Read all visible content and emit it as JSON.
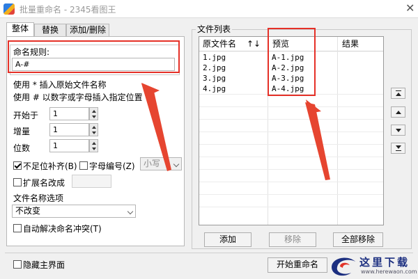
{
  "window": {
    "title": "批量重命名 - 2345看图王",
    "close_glyph": "✕"
  },
  "tabs": [
    "整体",
    "替换",
    "添加/删除"
  ],
  "naming_rule": {
    "label": "命名规则:",
    "value": "A-#"
  },
  "usage": [
    "使用 * 插入原始文件名称",
    "使用 # 以数字或字母插入指定位置"
  ],
  "start_at": {
    "label": "开始于",
    "value": "1"
  },
  "increment": {
    "label": "增量",
    "value": "1"
  },
  "digits": {
    "label": "位数",
    "value": "1"
  },
  "zero_pad": {
    "label": "不足位补齐(B)",
    "checked": true
  },
  "letter_numbering": {
    "label": "字母编号(Z)",
    "checked": false
  },
  "letter_case": {
    "value": "小写"
  },
  "change_extension": {
    "label": "扩展名改成",
    "checked": false,
    "value": ""
  },
  "filename_options": {
    "label": "文件名称选项",
    "value": "不改变"
  },
  "auto_resolve": {
    "label": "自动解决命名冲突(T)",
    "checked": false
  },
  "file_list": {
    "legend": "文件列表",
    "columns": {
      "original": "原文件名",
      "sort": "↑↓",
      "preview": "预览",
      "result": "结果"
    },
    "rows": [
      {
        "original": "1.jpg",
        "preview": "A-1.jpg",
        "result": ""
      },
      {
        "original": "2.jpg",
        "preview": "A-2.jpg",
        "result": ""
      },
      {
        "original": "3.jpg",
        "preview": "A-3.jpg",
        "result": ""
      },
      {
        "original": "4.jpg",
        "preview": "A-4.jpg",
        "result": ""
      }
    ]
  },
  "list_buttons": {
    "add": "添加",
    "remove": "移除",
    "remove_all": "全部移除"
  },
  "hide_main": {
    "label": "隐藏主界面",
    "checked": false
  },
  "start_rename": "开始重命名",
  "watermark": {
    "text": "这里下载",
    "url": "www.herewaon.com"
  },
  "colors": {
    "highlight": "#e53027",
    "arrow": "#e64530"
  }
}
